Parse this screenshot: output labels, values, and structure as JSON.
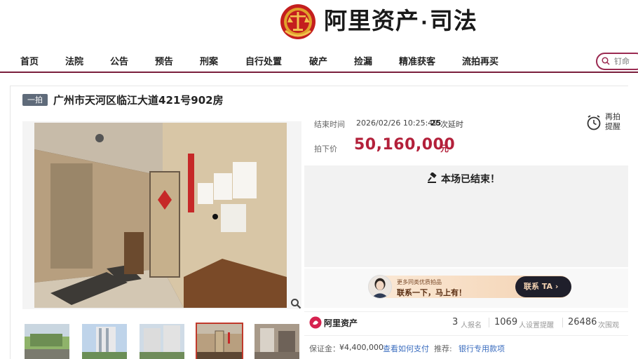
{
  "header": {
    "brand_main": "阿里资产",
    "brand_dot": "·",
    "brand_sub": "司法"
  },
  "nav": {
    "items": [
      "首页",
      "法院",
      "公告",
      "预告",
      "刑案",
      "自行处置",
      "破产",
      "捡漏",
      "精准获客",
      "流拍再买"
    ],
    "search_placeholder": "钉命"
  },
  "item": {
    "badge": "一拍",
    "title": "广州市天河区临江大道421号902房"
  },
  "auction": {
    "end_label": "结束时间",
    "end_time": "2026/02/26 10:25:49",
    "delay_count": "25",
    "delay_label": "次延时",
    "price_label": "拍下价",
    "price": "50,160,000",
    "price_unit": "元",
    "remind_label": "再拍提醒",
    "ended_text": "本场已结束！"
  },
  "promo": {
    "sub": "更多同类优质拍品",
    "main": "联系一下，马上有！",
    "button": "联系 TA ›"
  },
  "org": {
    "name": "阿里资产"
  },
  "stats": {
    "signup_count": "3",
    "signup_label": "人报名",
    "remind_count": "1069",
    "remind_label": "人设置提醒",
    "view_count": "26486",
    "view_label": "次围观"
  },
  "footer": {
    "deposit_label": "保证金：",
    "deposit_value": "¥4,400,000",
    "payment_link": "查看如何支付",
    "recommend_label": "推荐:",
    "recommend_link": "银行专用款项"
  },
  "colors": {
    "brand_accent": "#7a1f3c",
    "price": "#b3203a",
    "link": "#3b6dbf"
  }
}
